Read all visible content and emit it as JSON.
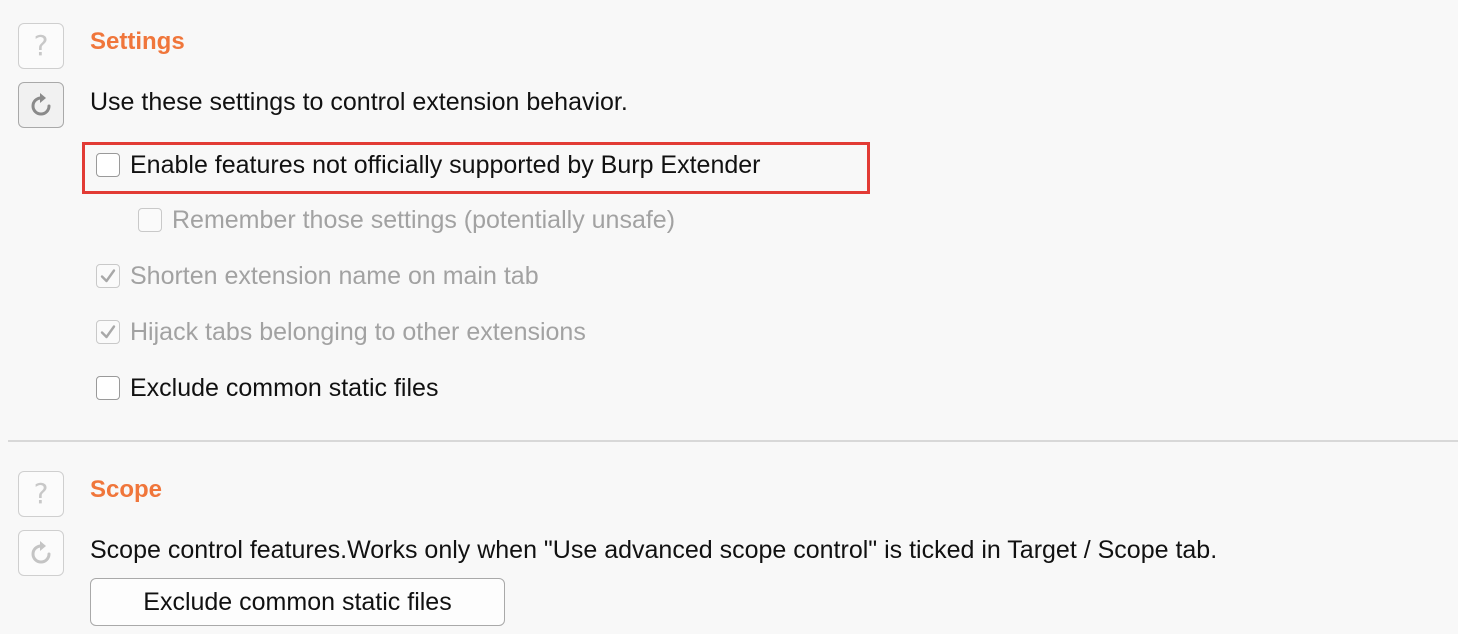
{
  "settings": {
    "title": "Settings",
    "description": "Use these settings to control extension behavior.",
    "help_glyph": "?",
    "help_icon": "question-mark-icon",
    "reset_icon": "reset-arrow-icon",
    "checkboxes": [
      {
        "label": "Enable features not officially supported by Burp Extender",
        "checked": false,
        "enabled": true,
        "highlighted": true
      },
      {
        "label": "Remember those settings (potentially unsafe)",
        "checked": false,
        "enabled": false
      },
      {
        "label": "Shorten extension name on main tab",
        "checked": true,
        "enabled": false
      },
      {
        "label": "Hijack tabs belonging to other extensions",
        "checked": true,
        "enabled": false
      },
      {
        "label": "Exclude common static files",
        "checked": false,
        "enabled": true
      }
    ]
  },
  "scope": {
    "title": "Scope",
    "description": "Scope control features.Works only when \"Use advanced scope control\" is ticked in Target / Scope tab.",
    "help_glyph": "?",
    "button_label": "Exclude common static files"
  },
  "colors": {
    "section_title": "#f0763b",
    "highlight_border": "#e23b35",
    "disabled_text": "#a2a2a2"
  }
}
